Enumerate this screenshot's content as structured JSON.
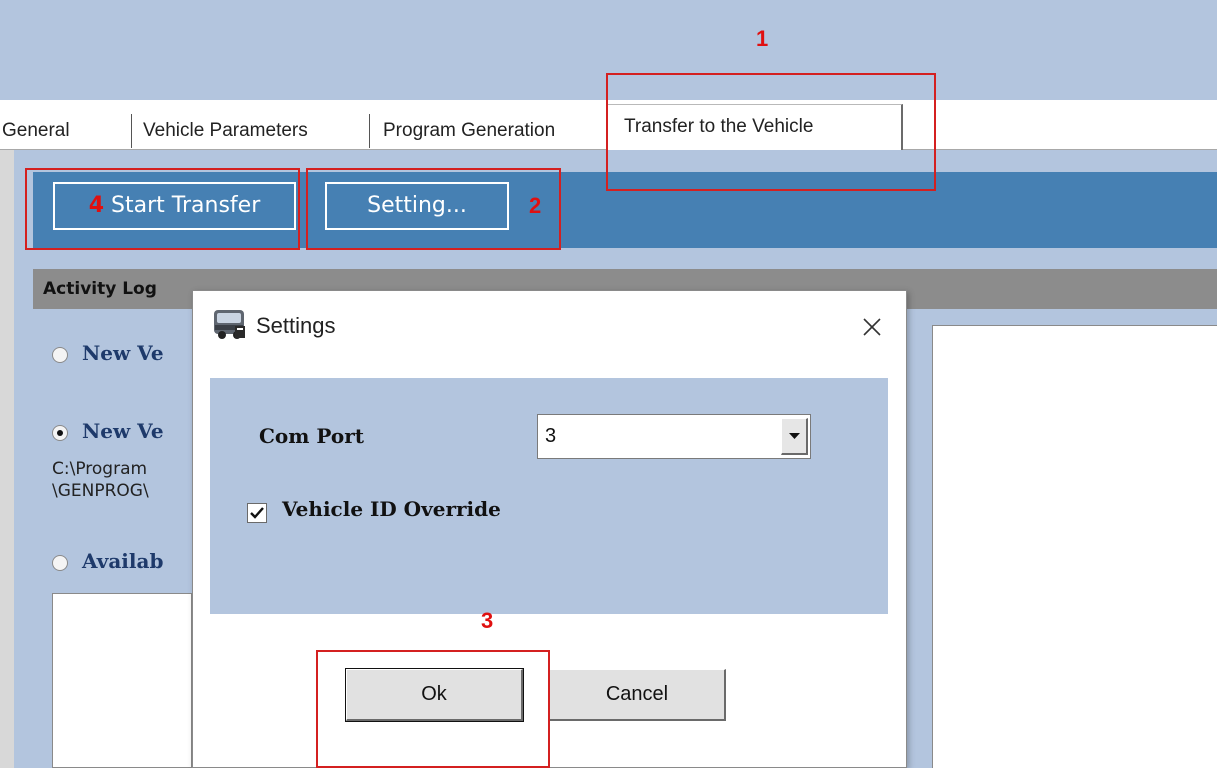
{
  "tabs": [
    {
      "label": "General",
      "active": false
    },
    {
      "label": "Vehicle Parameters",
      "active": false
    },
    {
      "label": "Program Generation",
      "active": false
    },
    {
      "label": "Transfer to the Vehicle",
      "active": true
    }
  ],
  "toolbar": {
    "start_transfer_label": "Start Transfer",
    "setting_label": "Setting...",
    "bg_color": "#4680b3"
  },
  "activity_log": {
    "title": "Activity Log",
    "radios": [
      {
        "label": "New Ve",
        "selected": false
      },
      {
        "label": "New Ve",
        "selected": true
      },
      {
        "label": "Availab",
        "selected": false
      }
    ],
    "path_line1": "C:\\Program",
    "path_line2": "\\GENPROG\\"
  },
  "dialog": {
    "title": "Settings",
    "com_port_label": "Com Port",
    "com_port_value": "3",
    "override_label": "Vehicle ID Override",
    "override_checked": true,
    "ok_label": "Ok",
    "cancel_label": "Cancel",
    "icon": "bus-icon"
  },
  "annotations": {
    "n1": "1",
    "n2": "2",
    "n3": "3",
    "n4": "4",
    "color": "#d42020"
  },
  "colors": {
    "panel_bg": "#b3c5de",
    "log_header_bg": "#8c8c8c"
  }
}
